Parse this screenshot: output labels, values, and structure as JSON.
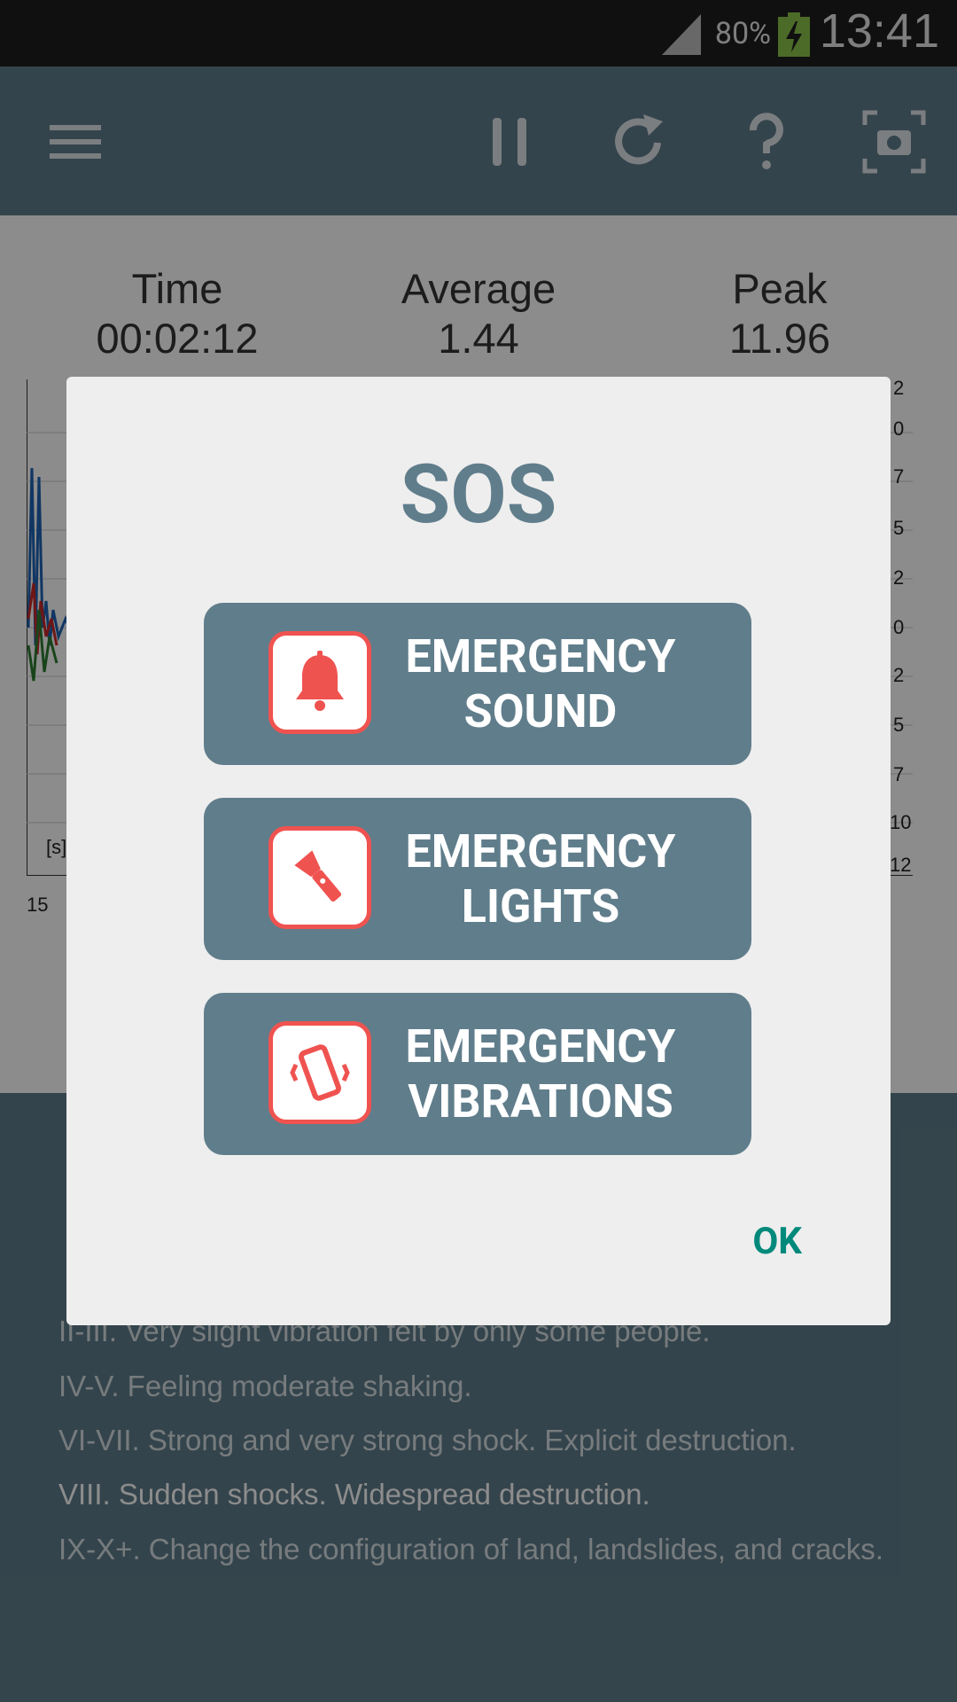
{
  "status_bar": {
    "battery_percent": "80%",
    "time": "13:41"
  },
  "toolbar": {
    "icons": [
      "menu-icon",
      "pause-icon",
      "refresh-icon",
      "help-icon",
      "screenshot-icon"
    ],
    "color": "#607d8b"
  },
  "stats": {
    "time_label": "Time",
    "time_value": "00:02:12",
    "average_label": "Average",
    "average_value": "1.44",
    "peak_label": "Peak",
    "peak_value": "11.96"
  },
  "chart": {
    "unit_label": "[s]",
    "x_tick_label": "15",
    "right_tick_labels": [
      "2",
      "0",
      "7",
      "5",
      "2",
      "0",
      "2",
      "5",
      "7",
      "10",
      "12"
    ]
  },
  "legend": {
    "lines": [
      "II-III. Very slight vibration felt by only some people.",
      "IV-V. Feeling moderate shaking.",
      "VI-VII. Strong and very strong shock. Explicit destruction.",
      "VIII. Sudden shocks. Widespread destruction.",
      "IX-X+. Change the configuration of land, landslides, and cracks."
    ]
  },
  "dialog": {
    "title": "SOS",
    "buttons": [
      {
        "line1": "EMERGENCY",
        "line2": "SOUND",
        "icon": "bell-icon"
      },
      {
        "line1": "EMERGENCY",
        "line2": "LIGHTS",
        "icon": "flashlight-icon"
      },
      {
        "line1": "EMERGENCY",
        "line2": "VIBRATIONS",
        "icon": "vibrate-icon"
      }
    ],
    "ok_label": "OK",
    "accent_color": "#607d8b",
    "icon_color": "#ef5350",
    "ok_color": "#00897b"
  }
}
